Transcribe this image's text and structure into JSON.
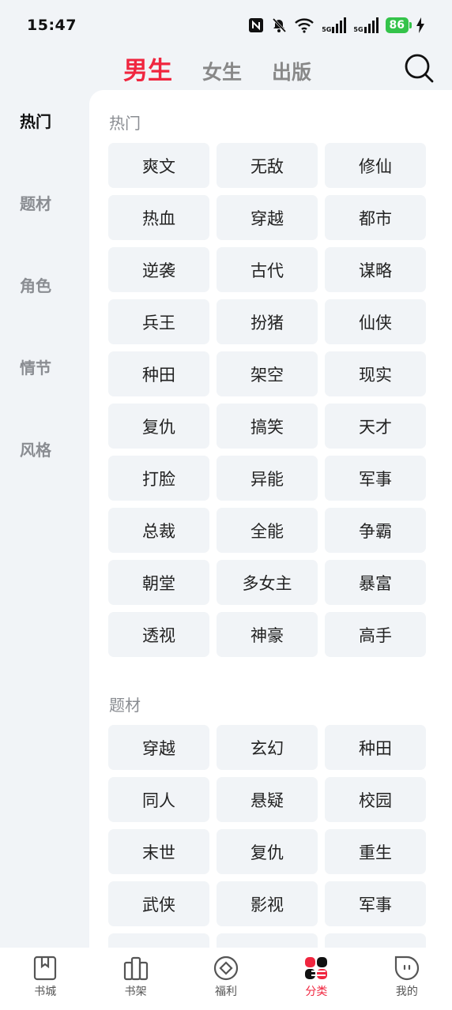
{
  "status": {
    "time": "15:47",
    "net1": "5G",
    "net2": "5G",
    "battery": "86"
  },
  "header": {
    "tabs": [
      {
        "label": "男生",
        "active": true
      },
      {
        "label": "女生",
        "active": false
      },
      {
        "label": "出版",
        "active": false
      }
    ],
    "search_icon": "search-icon"
  },
  "sidebar": {
    "items": [
      {
        "label": "热门",
        "active": true
      },
      {
        "label": "题材",
        "active": false
      },
      {
        "label": "角色",
        "active": false
      },
      {
        "label": "情节",
        "active": false
      },
      {
        "label": "风格",
        "active": false
      }
    ]
  },
  "sections": [
    {
      "title": "热门",
      "tags": [
        "爽文",
        "无敌",
        "修仙",
        "热血",
        "穿越",
        "都市",
        "逆袭",
        "古代",
        "谋略",
        "兵王",
        "扮猪",
        "仙侠",
        "种田",
        "架空",
        "现实",
        "复仇",
        "搞笑",
        "天才",
        "打脸",
        "异能",
        "军事",
        "总裁",
        "全能",
        "争霸",
        "朝堂",
        "多女主",
        "暴富",
        "透视",
        "神豪",
        "高手"
      ]
    },
    {
      "title": "题材",
      "tags": [
        "穿越",
        "玄幻",
        "种田",
        "同人",
        "悬疑",
        "校园",
        "末世",
        "复仇",
        "重生",
        "武侠",
        "影视",
        "军事",
        "",
        "",
        ""
      ]
    }
  ],
  "bottom_nav": {
    "items": [
      {
        "label": "书城",
        "icon": "bookstore-icon"
      },
      {
        "label": "书架",
        "icon": "bookshelf-icon"
      },
      {
        "label": "福利",
        "icon": "welfare-icon"
      },
      {
        "label": "分类",
        "icon": "category-icon",
        "active": true
      },
      {
        "label": "我的",
        "icon": "profile-icon"
      }
    ]
  },
  "colors": {
    "accent": "#f0263f",
    "background": "#f1f4f7",
    "tag_bg": "#f1f4f7",
    "battery": "#34c34a"
  }
}
